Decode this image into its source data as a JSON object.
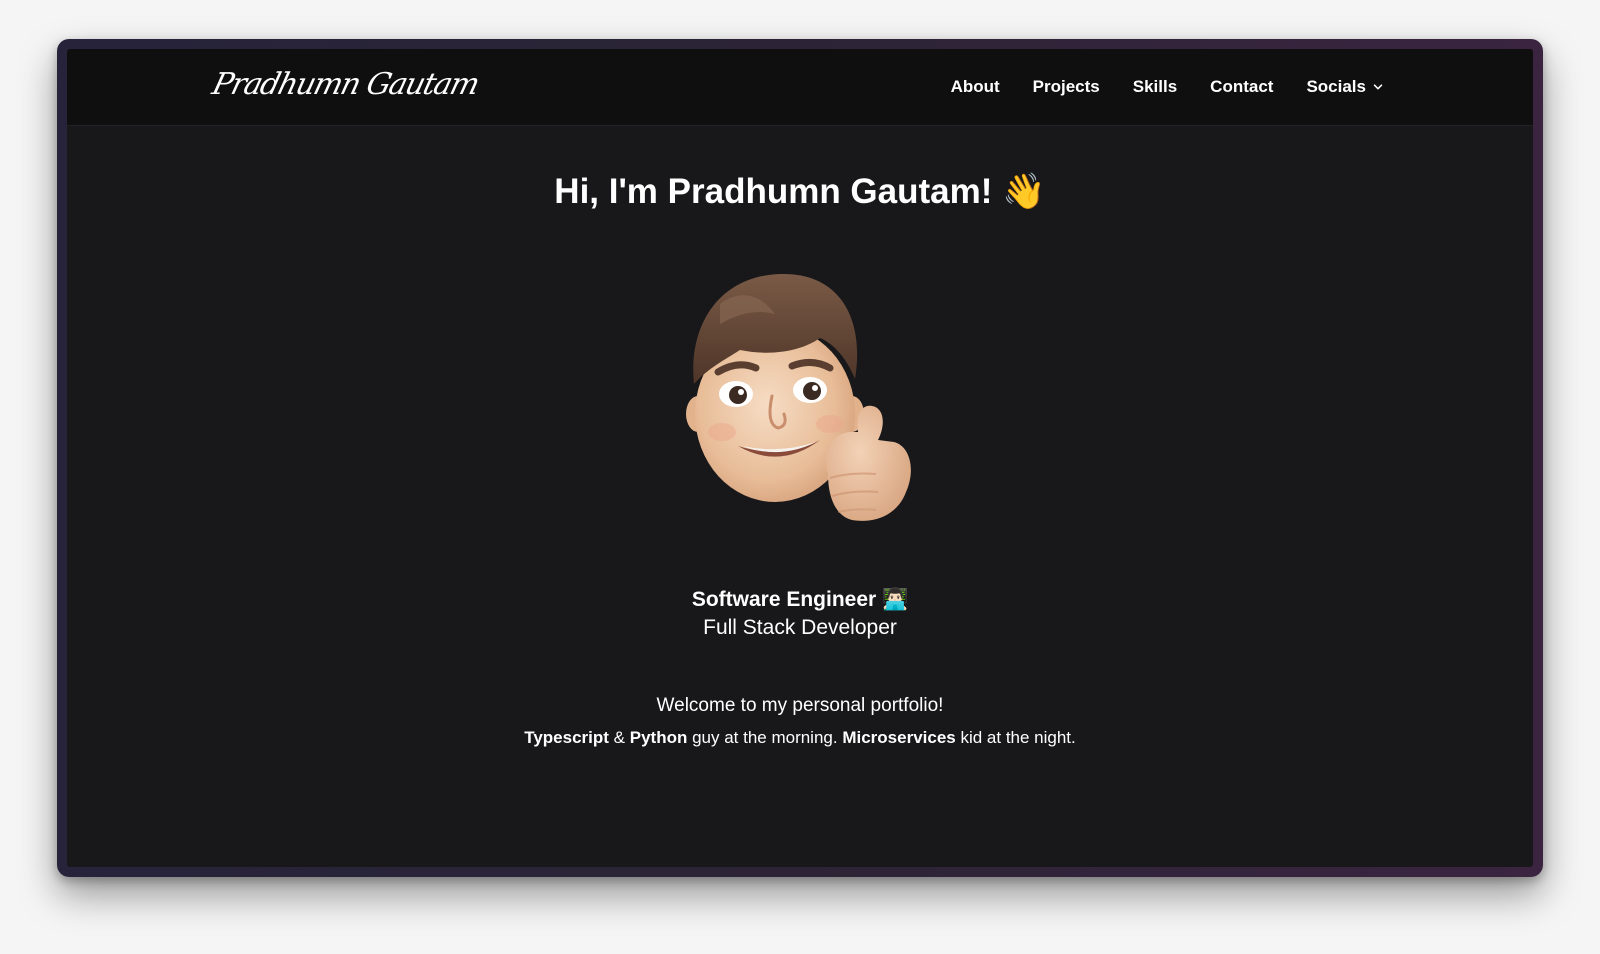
{
  "header": {
    "logo_text": "Pradhumn Gautam",
    "nav": [
      {
        "label": "About"
      },
      {
        "label": "Projects"
      },
      {
        "label": "Skills"
      },
      {
        "label": "Contact"
      },
      {
        "label": "Socials",
        "icon": "chevron-down-icon"
      }
    ]
  },
  "hero": {
    "title": "Hi, I'm Pradhumn Gautam! 👋",
    "avatar_icon": "memoji-thumbs-up-avatar",
    "role": "Software Engineer 👨🏻‍💻",
    "subrole": "Full Stack Developer",
    "welcome": "Welcome to my personal portfolio!",
    "tagline": {
      "part1_bold": "Typescript",
      "part2": " & ",
      "part3_bold": "Python",
      "part4": " guy at the morning. ",
      "part5_bold": "Microservices",
      "part6": " kid at the night."
    }
  },
  "colors": {
    "page_bg": "#18181b",
    "navbar_bg": "#0f0f10",
    "text": "#ffffff"
  }
}
